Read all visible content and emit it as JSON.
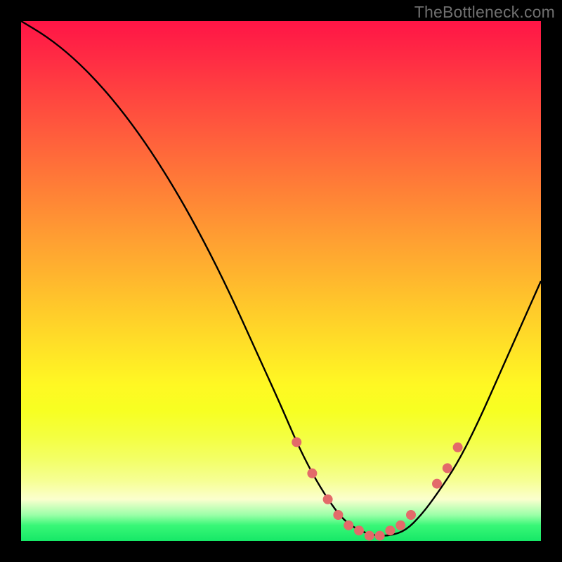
{
  "watermark": "TheBottleneck.com",
  "chart_data": {
    "type": "line",
    "title": "",
    "xlabel": "",
    "ylabel": "",
    "xlim": [
      0,
      100
    ],
    "ylim": [
      0,
      100
    ],
    "grid": false,
    "legend": false,
    "series": [
      {
        "name": "bottleneck-curve",
        "x": [
          0,
          5,
          10,
          15,
          20,
          25,
          30,
          35,
          40,
          45,
          50,
          53,
          56,
          59,
          62,
          65,
          68,
          71,
          74,
          77,
          80,
          84,
          88,
          92,
          96,
          100
        ],
        "y": [
          100,
          97,
          93,
          88,
          82,
          75,
          67,
          58,
          48,
          37,
          26,
          19,
          13,
          8,
          4,
          2,
          1,
          1,
          2,
          5,
          9,
          15,
          23,
          32,
          41,
          50
        ]
      }
    ],
    "markers": {
      "name": "highlighted-points",
      "x": [
        53,
        56,
        59,
        61,
        63,
        65,
        67,
        69,
        71,
        73,
        75,
        80,
        82,
        84
      ],
      "y": [
        19,
        13,
        8,
        5,
        3,
        2,
        1,
        1,
        2,
        3,
        5,
        11,
        14,
        18
      ],
      "color": "#e36a6a",
      "radius_px": 7
    },
    "background_gradient": {
      "top": "#ff1546",
      "mid": "#ffe033",
      "bottom": "#16e867"
    }
  }
}
